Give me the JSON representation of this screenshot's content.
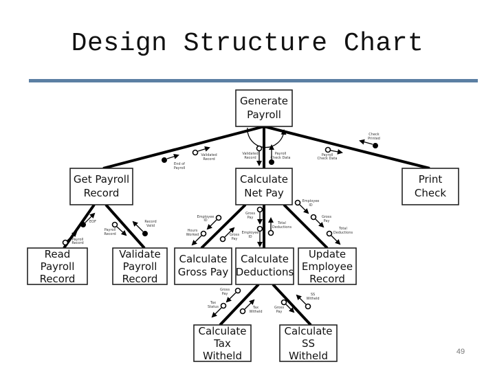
{
  "slide": {
    "title": "Design Structure Chart",
    "page_number": "49",
    "rule_color": "#5b7fa3"
  },
  "modules": {
    "generate_payroll": [
      "Generate",
      "Payroll"
    ],
    "get_payroll_record": [
      "Get Payroll",
      "Record"
    ],
    "calculate_net_pay": [
      "Calculate",
      "Net Pay"
    ],
    "print_check": [
      "Print",
      "Check"
    ],
    "read_payroll_record": [
      "Read",
      "Payroll",
      "Record"
    ],
    "validate_payroll_record": [
      "Validate",
      "Payroll",
      "Record"
    ],
    "calculate_gross_pay": [
      "Calculate",
      "Gross Pay"
    ],
    "calculate_deductions": [
      "Calculate",
      "Deductions"
    ],
    "update_employee_record": [
      "Update",
      "Employee",
      "Record"
    ],
    "calculate_tax_witheld": [
      "Calculate",
      "Tax",
      "Witheld"
    ],
    "calculate_ss_witheld": [
      "Calculate",
      "SS",
      "Witheld"
    ]
  },
  "flows": {
    "end_of_payroll": [
      "End of",
      "Payroll"
    ],
    "validated_record_left": [
      "Validated",
      "Record"
    ],
    "validated_record_center": [
      "Validated",
      "Record"
    ],
    "payroll_check_data": [
      "Payroll",
      "Check Data"
    ],
    "payroll_check_data_right": [
      "Payroll",
      "Check Data"
    ],
    "check_printed": [
      "Check",
      "Printed"
    ],
    "eof": [
      "EOF"
    ],
    "payroll_record_read": [
      "Payroll",
      "Record"
    ],
    "payroll_record_validate": [
      "Payroll",
      "Record"
    ],
    "record_valid": [
      "Record",
      "Valid"
    ],
    "employee_id_gross": [
      "Employee",
      "ID"
    ],
    "hours_worked": [
      "Hours",
      "Worked"
    ],
    "gross_pay_up": [
      "Gross",
      "Pay"
    ],
    "gross_pay_down": [
      "Gross",
      "Pay"
    ],
    "employee_id_deductions": [
      "Employee",
      "ID"
    ],
    "total_deductions_up": [
      "Total",
      "Deductions"
    ],
    "employee_id_update": [
      "Employee",
      "ID"
    ],
    "gross_pay_update": [
      "Gross",
      "Pay"
    ],
    "total_deductions_update": [
      "Total",
      "Deductions"
    ],
    "gross_pay_tax": [
      "Gross",
      "Pay"
    ],
    "tax_status": [
      "Tax",
      "Status"
    ],
    "tax_witheld": [
      "Tax",
      "Witheld"
    ],
    "gross_pay_ss": [
      "Gross",
      "Pay"
    ],
    "ss_witheld": [
      "SS",
      "Witheld"
    ]
  }
}
